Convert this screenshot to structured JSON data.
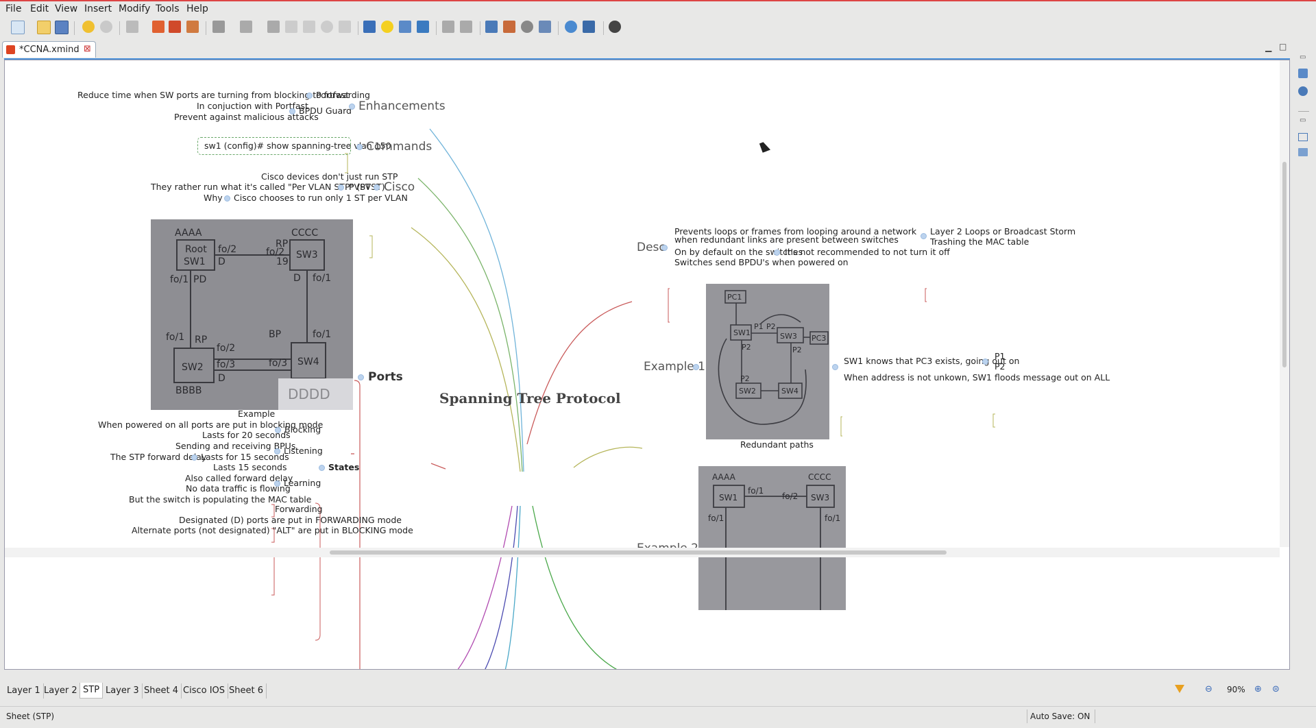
{
  "menu": [
    "File",
    "Edit",
    "View",
    "Insert",
    "Modify",
    "Tools",
    "Help"
  ],
  "document_tab": {
    "title": "*CCNA.xmind"
  },
  "central_topic": "Spanning Tree Protocol",
  "left": {
    "enhancements": {
      "label": "Enhancements",
      "portfast": {
        "label": "Portfast",
        "note": "Reduce time when SW ports are turning from blocking to forwarding"
      },
      "bpdu_guard": {
        "label": "BPDU Guard",
        "notes": [
          "In conjuction with Portfast",
          "Prevent against malicious attacks"
        ]
      }
    },
    "commands": {
      "label": "Commands",
      "command": "sw1 (config)# show spanning-tree vlan 150"
    },
    "cisco": {
      "label": "Cisco",
      "note1": "Cisco devices don't just run STP",
      "pvst": {
        "label": "PVST",
        "note": "They rather run what it's called \"Per VLAN STP\" (PVST)"
      },
      "choose": {
        "label": "Cisco chooses to run only 1 ST per VLAN",
        "why": "Why"
      }
    },
    "ports": {
      "label": "Ports",
      "image_caption": "Example",
      "states": {
        "label": "States",
        "blocking": {
          "label": "Blocking",
          "notes": [
            "When powered on all ports are put in blocking mode",
            "Lasts for 20 seconds"
          ]
        },
        "listening": {
          "label": "Listening",
          "notes": [
            "Sending and receiving BPUs"
          ],
          "sub": {
            "label": "Lasts for 15 seconds",
            "note": "The STP forward delay"
          }
        },
        "learning": {
          "label": "Learning",
          "notes": [
            "Lasts 15 seconds",
            "Also called forward delay",
            "No data traffic is flowing",
            "But the switch is populating the MAC table"
          ]
        },
        "forwarding": {
          "label": "Forwarding"
        }
      },
      "designated": "Designated (D) ports are put in FORWARDING mode",
      "alternate": "Alternate ports (not designated) \"ALT\" are put in BLOCKING mode"
    }
  },
  "right": {
    "desc": {
      "label": "Desc",
      "prevent": "Prevents loops or frames from looping around a network when redundant links are present between switches",
      "prevent_subs": [
        "Layer 2 Loops or Broadcast Storm",
        "Trashing the MAC table"
      ],
      "default": "On by default on the switches",
      "default_note": "It's not recommended to not turn it off",
      "bpdu": "Switches send BPDU's when powered on"
    },
    "example1": {
      "label": "Example 1",
      "image_caption": "Redundant paths",
      "knows": "SW1 knows that PC3 exists, going out on",
      "ports": [
        "P1",
        "P2"
      ],
      "floods": "When address is not unkown, SW1 floods message out on ALL"
    },
    "example2": {
      "label": "Example 2"
    }
  },
  "sketch_labels": {
    "top_left": [
      "AAAA",
      "Root",
      "SW1",
      "fo/2",
      "D",
      "fo/1",
      "PD"
    ],
    "top_right": [
      "CCCC",
      "RP",
      "fo/2",
      "19",
      "SW3",
      "D",
      "fo/1"
    ],
    "bottom_left": [
      "fo/1",
      "RP",
      "BP",
      "fo/2",
      "SW2",
      "fo/3",
      "BBBB",
      "D"
    ],
    "bottom_right": [
      "SW4",
      "fo/1",
      "DDDD",
      "fo/3"
    ],
    "ex1": [
      "PC1",
      "SW1",
      "P1",
      "P2",
      "SW3",
      "PC3",
      "P2",
      "P2",
      "SW2",
      "SW4",
      "P2"
    ],
    "ex2": [
      "AAAA",
      "CCCC",
      "SW1",
      "fo/1",
      "fo/2",
      "SW3",
      "fo/1",
      "fo/1"
    ]
  },
  "sheets": [
    "Layer 1",
    "Layer 2",
    "STP",
    "Layer 3",
    "Sheet 4",
    "Cisco IOS",
    "Sheet 6"
  ],
  "active_sheet": "STP",
  "zoom": "90%",
  "status": {
    "sheet": "Sheet (STP)",
    "autosave": "Auto Save: ON"
  },
  "colors": {
    "accent": "#4a90d9",
    "canvas": "#ffffff",
    "chrome": "#e8e8e7"
  }
}
